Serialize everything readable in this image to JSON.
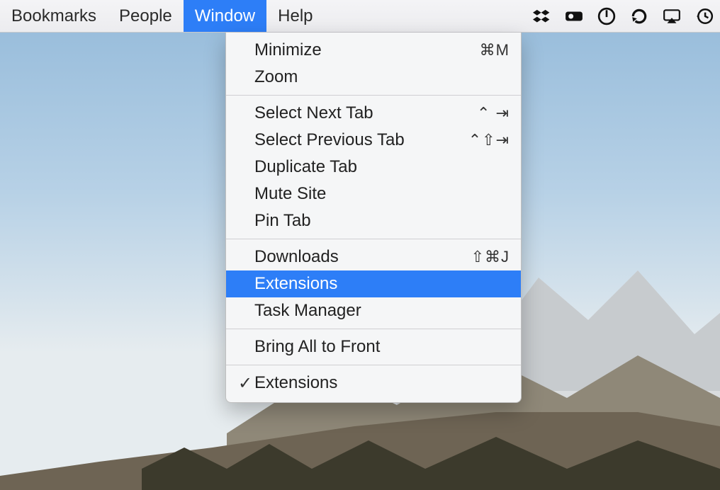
{
  "menubar": {
    "items": [
      {
        "label": "Bookmarks",
        "active": false
      },
      {
        "label": "People",
        "active": false
      },
      {
        "label": "Window",
        "active": true
      },
      {
        "label": "Help",
        "active": false
      }
    ],
    "status_icons": [
      "dropbox",
      "carbon-copy",
      "power",
      "refresh",
      "airplay",
      "time-machine"
    ]
  },
  "window_menu": {
    "sections": [
      [
        {
          "label": "Minimize",
          "shortcut": "⌘M"
        },
        {
          "label": "Zoom",
          "shortcut": ""
        }
      ],
      [
        {
          "label": "Select Next Tab",
          "shortcut": "⌃ ⇥"
        },
        {
          "label": "Select Previous Tab",
          "shortcut": "⌃⇧⇥"
        },
        {
          "label": "Duplicate Tab",
          "shortcut": ""
        },
        {
          "label": "Mute Site",
          "shortcut": ""
        },
        {
          "label": "Pin Tab",
          "shortcut": ""
        }
      ],
      [
        {
          "label": "Downloads",
          "shortcut": "⇧⌘J"
        },
        {
          "label": "Extensions",
          "shortcut": "",
          "highlight": true
        },
        {
          "label": "Task Manager",
          "shortcut": ""
        }
      ],
      [
        {
          "label": "Bring All to Front",
          "shortcut": ""
        }
      ],
      [
        {
          "label": "Extensions",
          "shortcut": "",
          "checked": true
        }
      ]
    ]
  }
}
